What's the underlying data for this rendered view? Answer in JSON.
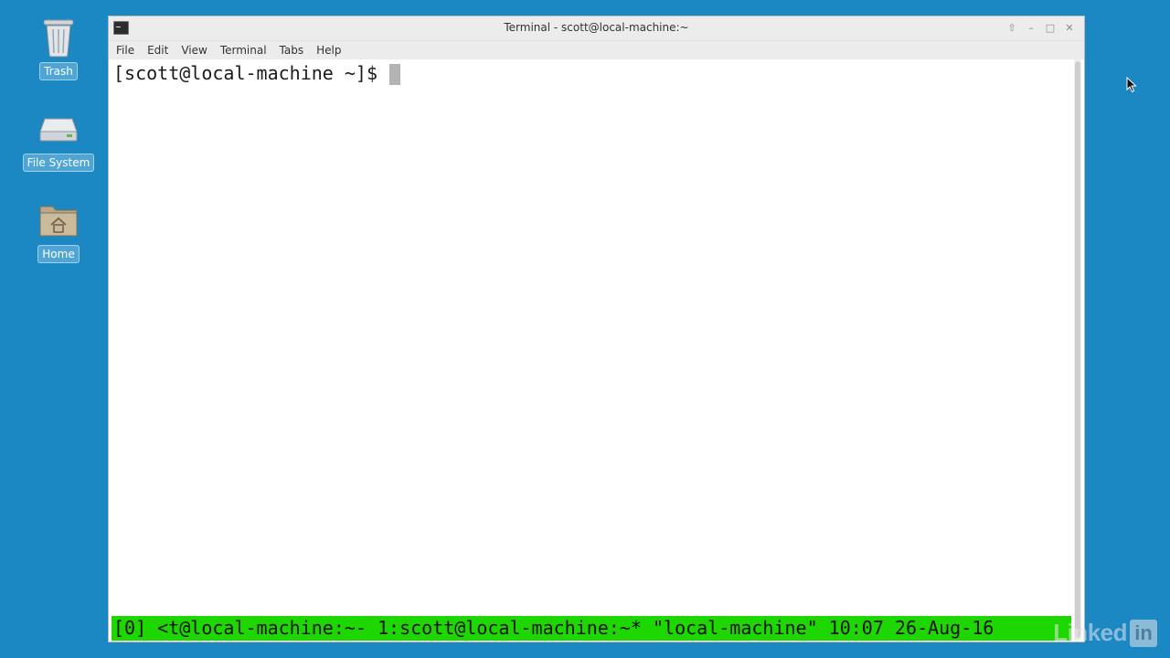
{
  "desktop": {
    "icons": [
      {
        "label": "Trash",
        "icon": "trash-icon"
      },
      {
        "label": "File System",
        "icon": "drive-icon"
      },
      {
        "label": "Home",
        "icon": "home-folder-icon"
      }
    ]
  },
  "window": {
    "title": "Terminal - scott@local-machine:~",
    "controls": {
      "up": "⇧",
      "minimize": "–",
      "maximize": "□",
      "close": "✕"
    },
    "menu": [
      "File",
      "Edit",
      "View",
      "Terminal",
      "Tabs",
      "Help"
    ]
  },
  "terminal": {
    "prompt": "[scott@local-machine ~]$ ",
    "statusbar": "[0] <t@local-machine:~- 1:scott@local-machine:~* \"local-machine\" 10:07 26-Aug-16",
    "statusbar_color": "#1fd700"
  },
  "watermark": {
    "text": "Linked",
    "box": "in"
  }
}
